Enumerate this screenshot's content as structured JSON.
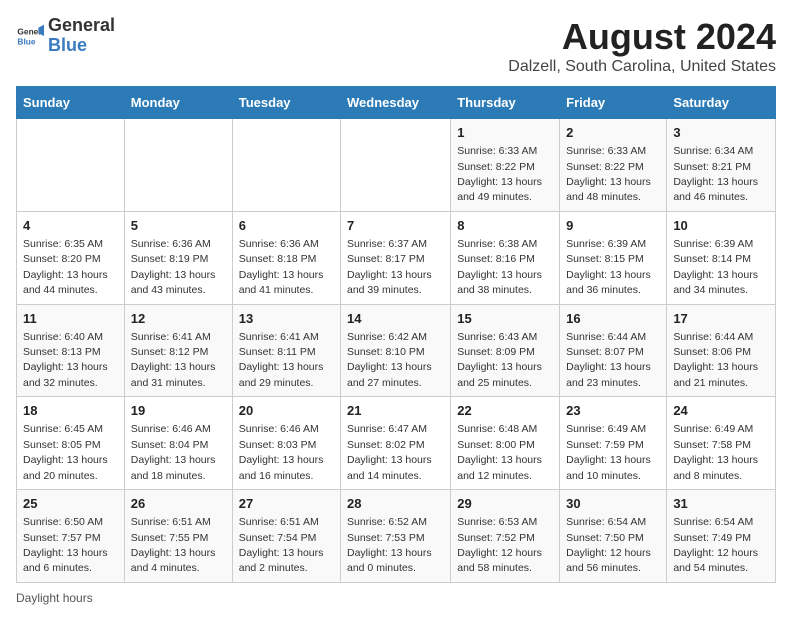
{
  "logo": {
    "general": "General",
    "blue": "Blue"
  },
  "title": "August 2024",
  "subtitle": "Dalzell, South Carolina, United States",
  "days_of_week": [
    "Sunday",
    "Monday",
    "Tuesday",
    "Wednesday",
    "Thursday",
    "Friday",
    "Saturday"
  ],
  "footer": "Daylight hours",
  "weeks": [
    [
      {
        "day": "",
        "sunrise": "",
        "sunset": "",
        "daylight": ""
      },
      {
        "day": "",
        "sunrise": "",
        "sunset": "",
        "daylight": ""
      },
      {
        "day": "",
        "sunrise": "",
        "sunset": "",
        "daylight": ""
      },
      {
        "day": "",
        "sunrise": "",
        "sunset": "",
        "daylight": ""
      },
      {
        "day": "1",
        "sunrise": "6:33 AM",
        "sunset": "8:22 PM",
        "daylight": "13 hours and 49 minutes."
      },
      {
        "day": "2",
        "sunrise": "6:33 AM",
        "sunset": "8:22 PM",
        "daylight": "13 hours and 48 minutes."
      },
      {
        "day": "3",
        "sunrise": "6:34 AM",
        "sunset": "8:21 PM",
        "daylight": "13 hours and 46 minutes."
      }
    ],
    [
      {
        "day": "4",
        "sunrise": "6:35 AM",
        "sunset": "8:20 PM",
        "daylight": "13 hours and 44 minutes."
      },
      {
        "day": "5",
        "sunrise": "6:36 AM",
        "sunset": "8:19 PM",
        "daylight": "13 hours and 43 minutes."
      },
      {
        "day": "6",
        "sunrise": "6:36 AM",
        "sunset": "8:18 PM",
        "daylight": "13 hours and 41 minutes."
      },
      {
        "day": "7",
        "sunrise": "6:37 AM",
        "sunset": "8:17 PM",
        "daylight": "13 hours and 39 minutes."
      },
      {
        "day": "8",
        "sunrise": "6:38 AM",
        "sunset": "8:16 PM",
        "daylight": "13 hours and 38 minutes."
      },
      {
        "day": "9",
        "sunrise": "6:39 AM",
        "sunset": "8:15 PM",
        "daylight": "13 hours and 36 minutes."
      },
      {
        "day": "10",
        "sunrise": "6:39 AM",
        "sunset": "8:14 PM",
        "daylight": "13 hours and 34 minutes."
      }
    ],
    [
      {
        "day": "11",
        "sunrise": "6:40 AM",
        "sunset": "8:13 PM",
        "daylight": "13 hours and 32 minutes."
      },
      {
        "day": "12",
        "sunrise": "6:41 AM",
        "sunset": "8:12 PM",
        "daylight": "13 hours and 31 minutes."
      },
      {
        "day": "13",
        "sunrise": "6:41 AM",
        "sunset": "8:11 PM",
        "daylight": "13 hours and 29 minutes."
      },
      {
        "day": "14",
        "sunrise": "6:42 AM",
        "sunset": "8:10 PM",
        "daylight": "13 hours and 27 minutes."
      },
      {
        "day": "15",
        "sunrise": "6:43 AM",
        "sunset": "8:09 PM",
        "daylight": "13 hours and 25 minutes."
      },
      {
        "day": "16",
        "sunrise": "6:44 AM",
        "sunset": "8:07 PM",
        "daylight": "13 hours and 23 minutes."
      },
      {
        "day": "17",
        "sunrise": "6:44 AM",
        "sunset": "8:06 PM",
        "daylight": "13 hours and 21 minutes."
      }
    ],
    [
      {
        "day": "18",
        "sunrise": "6:45 AM",
        "sunset": "8:05 PM",
        "daylight": "13 hours and 20 minutes."
      },
      {
        "day": "19",
        "sunrise": "6:46 AM",
        "sunset": "8:04 PM",
        "daylight": "13 hours and 18 minutes."
      },
      {
        "day": "20",
        "sunrise": "6:46 AM",
        "sunset": "8:03 PM",
        "daylight": "13 hours and 16 minutes."
      },
      {
        "day": "21",
        "sunrise": "6:47 AM",
        "sunset": "8:02 PM",
        "daylight": "13 hours and 14 minutes."
      },
      {
        "day": "22",
        "sunrise": "6:48 AM",
        "sunset": "8:00 PM",
        "daylight": "13 hours and 12 minutes."
      },
      {
        "day": "23",
        "sunrise": "6:49 AM",
        "sunset": "7:59 PM",
        "daylight": "13 hours and 10 minutes."
      },
      {
        "day": "24",
        "sunrise": "6:49 AM",
        "sunset": "7:58 PM",
        "daylight": "13 hours and 8 minutes."
      }
    ],
    [
      {
        "day": "25",
        "sunrise": "6:50 AM",
        "sunset": "7:57 PM",
        "daylight": "13 hours and 6 minutes."
      },
      {
        "day": "26",
        "sunrise": "6:51 AM",
        "sunset": "7:55 PM",
        "daylight": "13 hours and 4 minutes."
      },
      {
        "day": "27",
        "sunrise": "6:51 AM",
        "sunset": "7:54 PM",
        "daylight": "13 hours and 2 minutes."
      },
      {
        "day": "28",
        "sunrise": "6:52 AM",
        "sunset": "7:53 PM",
        "daylight": "13 hours and 0 minutes."
      },
      {
        "day": "29",
        "sunrise": "6:53 AM",
        "sunset": "7:52 PM",
        "daylight": "12 hours and 58 minutes."
      },
      {
        "day": "30",
        "sunrise": "6:54 AM",
        "sunset": "7:50 PM",
        "daylight": "12 hours and 56 minutes."
      },
      {
        "day": "31",
        "sunrise": "6:54 AM",
        "sunset": "7:49 PM",
        "daylight": "12 hours and 54 minutes."
      }
    ]
  ]
}
